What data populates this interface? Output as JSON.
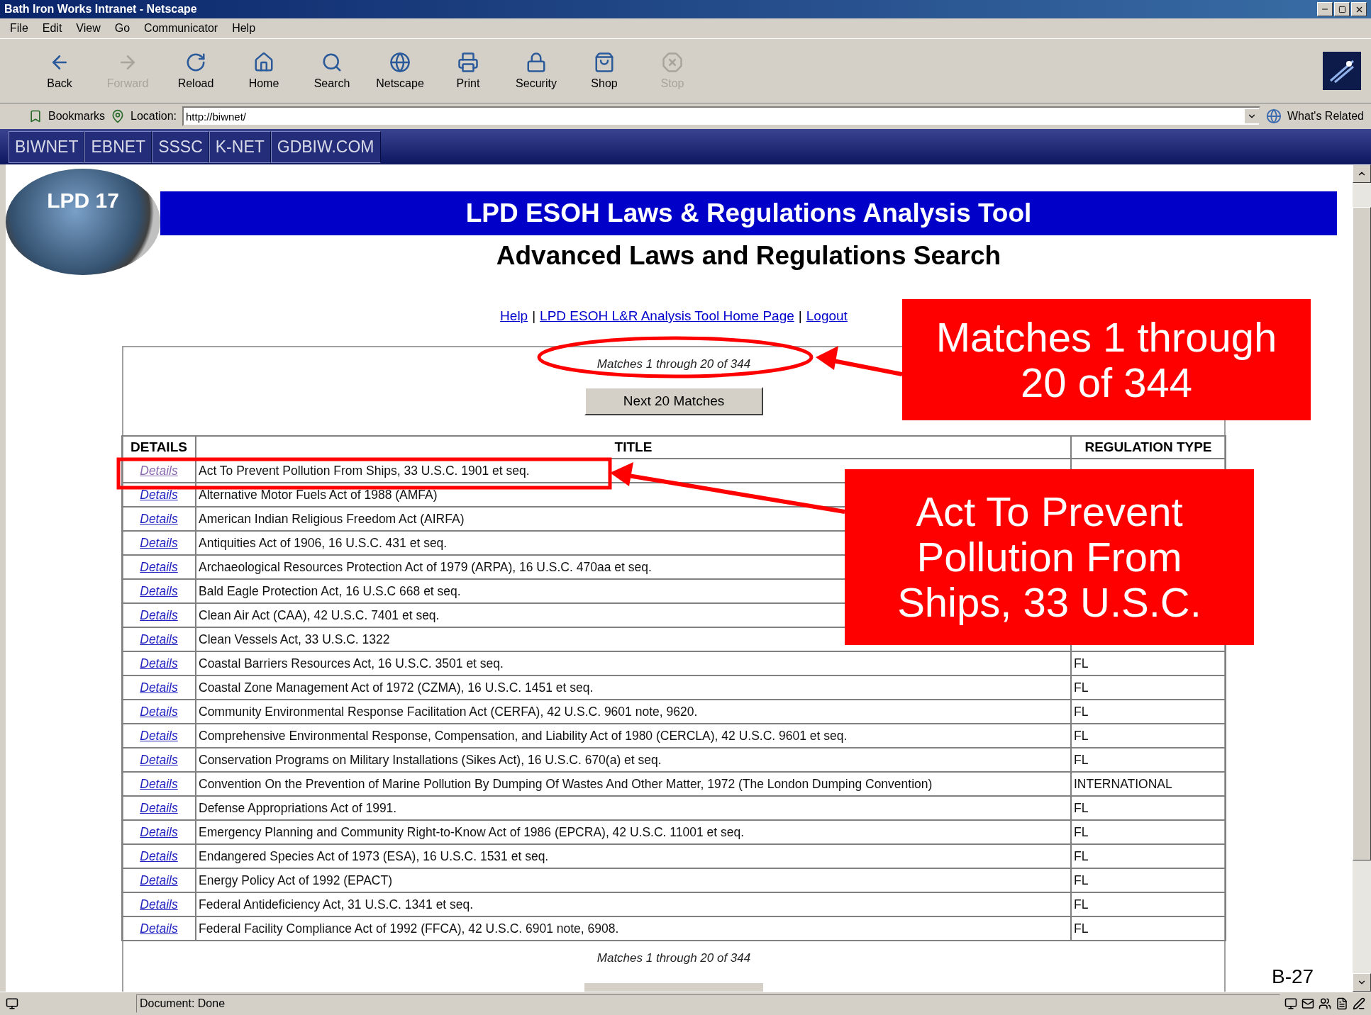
{
  "window": {
    "title": "Bath Iron Works Intranet - Netscape"
  },
  "menu": [
    "File",
    "Edit",
    "View",
    "Go",
    "Communicator",
    "Help"
  ],
  "toolbar": [
    {
      "kind": "back",
      "label": "Back",
      "disabled": false
    },
    {
      "kind": "forward",
      "label": "Forward",
      "disabled": true
    },
    {
      "kind": "reload",
      "label": "Reload",
      "disabled": false
    },
    {
      "kind": "home",
      "label": "Home",
      "disabled": false
    },
    {
      "kind": "search",
      "label": "Search",
      "disabled": false
    },
    {
      "kind": "netscape",
      "label": "Netscape",
      "disabled": false
    },
    {
      "kind": "print",
      "label": "Print",
      "disabled": false
    },
    {
      "kind": "security",
      "label": "Security",
      "disabled": false
    },
    {
      "kind": "shop",
      "label": "Shop",
      "disabled": false
    },
    {
      "kind": "stop",
      "label": "Stop",
      "disabled": true
    }
  ],
  "location_bar": {
    "bookmarks": "Bookmarks",
    "label": "Location:",
    "url": "http://biwnet/",
    "related": "What's Related"
  },
  "nav_tabs": [
    "BIWNET",
    "EBNET",
    "SSSC",
    "K-NET",
    "GDBIW.COM"
  ],
  "page": {
    "logo_text": "LPD 17",
    "title": "LPD ESOH Laws & Regulations Analysis Tool",
    "subtitle": "Advanced Laws and Regulations Search",
    "links": [
      "Help",
      "LPD ESOH L&R Analysis Tool Home Page",
      "Logout"
    ],
    "link_separator": "|",
    "matches_top": "Matches 1 through 20 of 344",
    "next_button": "Next 20 Matches",
    "table": {
      "columns": [
        "DETAILS",
        "TITLE",
        "REGULATION TYPE"
      ],
      "rows": [
        {
          "details": "Details",
          "visited": true,
          "title": "Act To Prevent Pollution From Ships, 33 U.S.C. 1901 et seq."
        },
        {
          "details": "Details",
          "visited": false,
          "title": "Alternative Motor Fuels Act of 1988 (AMFA)"
        },
        {
          "details": "Details",
          "visited": false,
          "title": "American Indian Religious Freedom Act (AIRFA)"
        },
        {
          "details": "Details",
          "visited": false,
          "title": "Antiquities Act of 1906, 16 U.S.C. 431 et seq."
        },
        {
          "details": "Details",
          "visited": false,
          "title": "Archaeological Resources Protection Act of 1979 (ARPA), 16 U.S.C. 470aa et seq."
        },
        {
          "details": "Details",
          "visited": false,
          "title": "Bald Eagle Protection Act, 16 U.S.C 668 et seq."
        },
        {
          "details": "Details",
          "visited": false,
          "title": "Clean Air Act (CAA), 42 U.S.C. 7401 et seq."
        },
        {
          "details": "Details",
          "visited": false,
          "title": "Clean Vessels Act, 33 U.S.C. 1322"
        },
        {
          "details": "Details",
          "visited": false,
          "title": "Coastal Barriers Resources Act, 16 U.S.C. 3501 et seq.",
          "regulation_type": "FL"
        },
        {
          "details": "Details",
          "visited": false,
          "title": "Coastal Zone Management Act of 1972 (CZMA), 16 U.S.C. 1451 et seq.",
          "regulation_type": "FL"
        },
        {
          "details": "Details",
          "visited": false,
          "title": "Community Environmental Response Facilitation Act (CERFA), 42 U.S.C. 9601 note, 9620.",
          "regulation_type": "FL"
        },
        {
          "details": "Details",
          "visited": false,
          "title": "Comprehensive Environmental Response, Compensation, and Liability Act of 1980 (CERCLA), 42 U.S.C. 9601 et seq.",
          "regulation_type": "FL"
        },
        {
          "details": "Details",
          "visited": false,
          "title": "Conservation Programs on Military Installations (Sikes Act), 16 U.S.C. 670(a) et seq.",
          "regulation_type": "FL"
        },
        {
          "details": "Details",
          "visited": false,
          "title": "Convention On the Prevention of Marine Pollution By Dumping Of Wastes And Other Matter, 1972 (The London Dumping Convention)",
          "regulation_type": "INTERNATIONAL"
        },
        {
          "details": "Details",
          "visited": false,
          "title": "Defense Appropriations Act of 1991.",
          "regulation_type": "FL"
        },
        {
          "details": "Details",
          "visited": false,
          "title": "Emergency Planning and Community Right-to-Know Act of 1986 (EPCRA), 42 U.S.C. 11001 et seq.",
          "regulation_type": "FL"
        },
        {
          "details": "Details",
          "visited": false,
          "title": "Endangered Species Act of 1973 (ESA), 16 U.S.C. 1531 et seq.",
          "regulation_type": "FL"
        },
        {
          "details": "Details",
          "visited": false,
          "title": "Energy Policy Act of 1992 (EPACT)",
          "regulation_type": "FL"
        },
        {
          "details": "Details",
          "visited": false,
          "title": "Federal Antideficiency Act, 31 U.S.C. 1341 et seq.",
          "regulation_type": "FL"
        },
        {
          "details": "Details",
          "visited": false,
          "title": "Federal Facility Compliance Act of 1992 (FFCA), 42 U.S.C. 6901 note, 6908.",
          "regulation_type": "FL"
        }
      ]
    },
    "matches_bottom": "Matches 1 through 20 of 344"
  },
  "status_bar": {
    "text": "Document: Done"
  },
  "annotations": [
    {
      "kind": "matches",
      "text": "Matches 1 through 20 of 344"
    },
    {
      "kind": "row",
      "text": "Act To Prevent Pollution From Ships, 33 U.S.C."
    }
  ],
  "slide_number": "B-27"
}
